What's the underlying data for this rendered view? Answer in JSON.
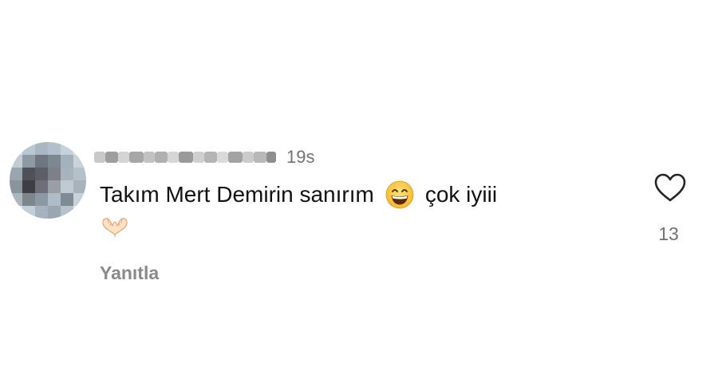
{
  "comment": {
    "timestamp": "19s",
    "text_before_emoji": "Takım Mert Demirin sanırım",
    "inline_emoji": "grinning-face-with-smiling-eyes",
    "text_after_emoji": "çok iyiii",
    "trailing_emoji": "heart-hands",
    "reply_label": "Yanıtla",
    "like_count": "13",
    "like_icon": "heart-outline-icon"
  },
  "colors": {
    "text": "#111111",
    "muted": "#737373",
    "reply": "#8a8a8a"
  }
}
